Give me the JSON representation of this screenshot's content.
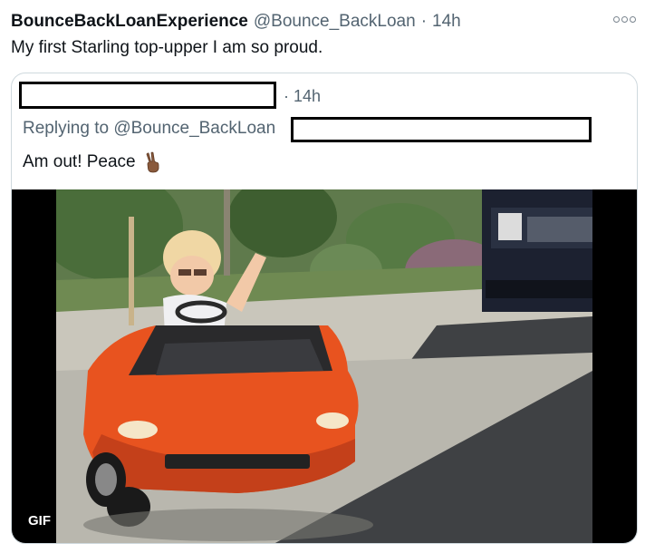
{
  "tweet": {
    "author_name": "BounceBackLoanExperience",
    "author_handle": "@Bounce_BackLoan",
    "separator": "·",
    "time": "14h",
    "text": "My first Starling top-upper I am so proud."
  },
  "more_icon": "more-horizontal-icon",
  "quote": {
    "time": "· 14h",
    "replying_to_label": "Replying to",
    "replying_to_handle": "@Bounce_BackLoan",
    "text": "Am out! Peace",
    "emoji_icon": "victory-hand-icon",
    "media": {
      "badge": "GIF"
    }
  }
}
